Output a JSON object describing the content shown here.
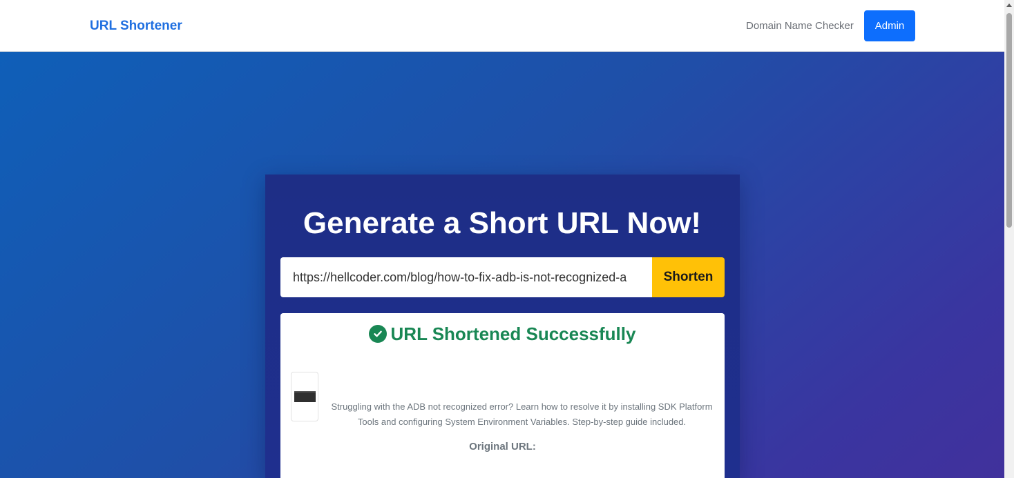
{
  "navbar": {
    "brand": "URL Shortener",
    "links": [
      "Domain Name Checker"
    ],
    "admin_label": "Admin"
  },
  "hero": {
    "title": "Generate a Short URL Now!",
    "url_input_value": "https://hellcoder.com/blog/how-to-fix-adb-is-not-recognized-a",
    "shorten_label": "Shorten"
  },
  "result": {
    "success_text": "URL Shortened Successfully",
    "description": "Struggling with the ADB not recognized error? Learn how to resolve it by installing SDK Platform Tools and configuring System Environment Variables. Step-by-step guide included.",
    "original_url_label": "Original URL:"
  },
  "icons": {
    "success": "check-circle-icon"
  },
  "colors": {
    "brand": "#1f6fe0",
    "admin_button": "#0d6efd",
    "shorten_button": "#ffc107",
    "success": "#198754"
  }
}
